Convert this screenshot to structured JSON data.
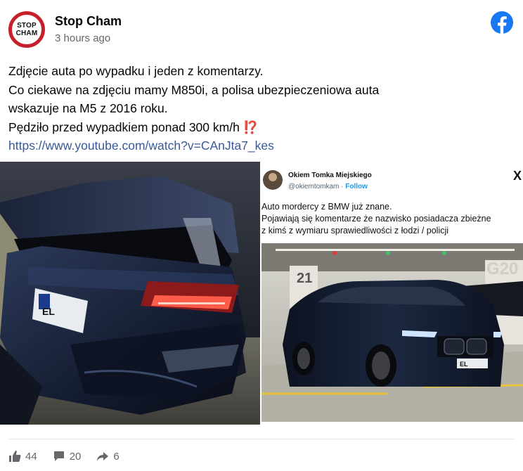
{
  "post": {
    "page_name": "Stop Cham",
    "avatar_line1": "STOP",
    "avatar_line2": "CHAM",
    "timestamp": "3 hours ago",
    "text_lines": [
      "Zdjęcie auta po wypadku i jeden z komentarzy.",
      "Co ciekawe na zdjęciu mamy M850i, a polisa ubezpieczeniowa auta",
      "wskazuje na M5 z 2016 roku.",
      "Pędziło przed wypadkiem ponad 300 km/h"
    ],
    "emoji": "⁉️",
    "link": "https://www.youtube.com/watch?v=CAnJta7_kes"
  },
  "tweet": {
    "author": "Okiem Tomka Miejskiego",
    "handle": "@okiemtomkam",
    "separator": " · ",
    "follow": "Follow",
    "x_icon": "X",
    "text_lines": [
      "Auto mordercy z BMW już znane.",
      "Pojawiają się komentarze że nazwisko posiadacza zbieżne",
      "z kimś z wymiaru sprawiedliwości z łodzi / policji"
    ],
    "garage_sign": "G20",
    "pillar_sign": "21",
    "plate_text": "EL"
  },
  "left_photo": {
    "plate_text": "EL"
  },
  "reactions": {
    "likes": "44",
    "comments": "20",
    "shares": "6"
  },
  "colors": {
    "brand_blue": "#1877f2",
    "link_blue": "#385898",
    "stop_red": "#c8202a",
    "meta_gray": "#65676b"
  },
  "icons": [
    "facebook-logo-icon",
    "like-icon",
    "comment-icon",
    "share-icon",
    "x-logo-icon"
  ]
}
